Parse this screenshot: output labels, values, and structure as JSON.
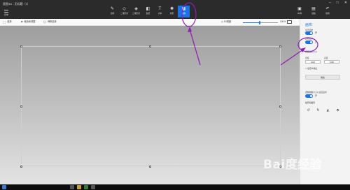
{
  "app": {
    "title": "画图3D - 无标题（1）"
  },
  "menu": {
    "label": "菜单"
  },
  "toolbar": {
    "tools": [
      {
        "label": "画笔",
        "icon": "brush-icon"
      },
      {
        "label": "二维形状",
        "icon": "shape-2d-icon"
      },
      {
        "label": "三维形状",
        "icon": "shape-3d-icon"
      },
      {
        "label": "贴纸",
        "icon": "sticker-icon"
      },
      {
        "label": "文本",
        "icon": "text-icon"
      },
      {
        "label": "效果",
        "icon": "effects-icon"
      },
      {
        "label": "画布",
        "icon": "canvas-icon",
        "active": true
      }
    ],
    "right_tools": [
      {
        "label": "3D库",
        "icon": "library-3d-icon"
      },
      {
        "label": "粘贴",
        "icon": "paste-icon"
      },
      {
        "label": "撤消",
        "icon": "undo-icon"
      }
    ]
  },
  "subbar": {
    "select_label": "选择",
    "crop_label": "裁剪和调整",
    "magic_label": "神奇选择",
    "view3d_label": "3D视图",
    "zoom_value": "100%",
    "zoom_level": 0.48
  },
  "panel": {
    "title": "画布",
    "show_canvas_label": "显示画布",
    "show_canvas_state": "开",
    "transparent_label": "透明画布",
    "transparent_state": "开",
    "resize_label": "调整画布大小",
    "width_label": "宽度",
    "height_label": "高度",
    "width_value": "1920",
    "height_value": "1080",
    "lock_label": "锁定纵横比",
    "unit_value": "像素",
    "resize_image_label": "调整图像大小以适应画布",
    "resize_image_state": "开",
    "rotate_label": "旋转和翻转"
  },
  "colors": {
    "accent": "#1a73e8",
    "annotation": "#8e1fb0",
    "toolbar_bg": "#2b2b2b",
    "panel_bg": "#f3f3f3"
  },
  "watermark": {
    "text": "Bai度经验",
    "sub": "jingyan.baidu.com"
  }
}
